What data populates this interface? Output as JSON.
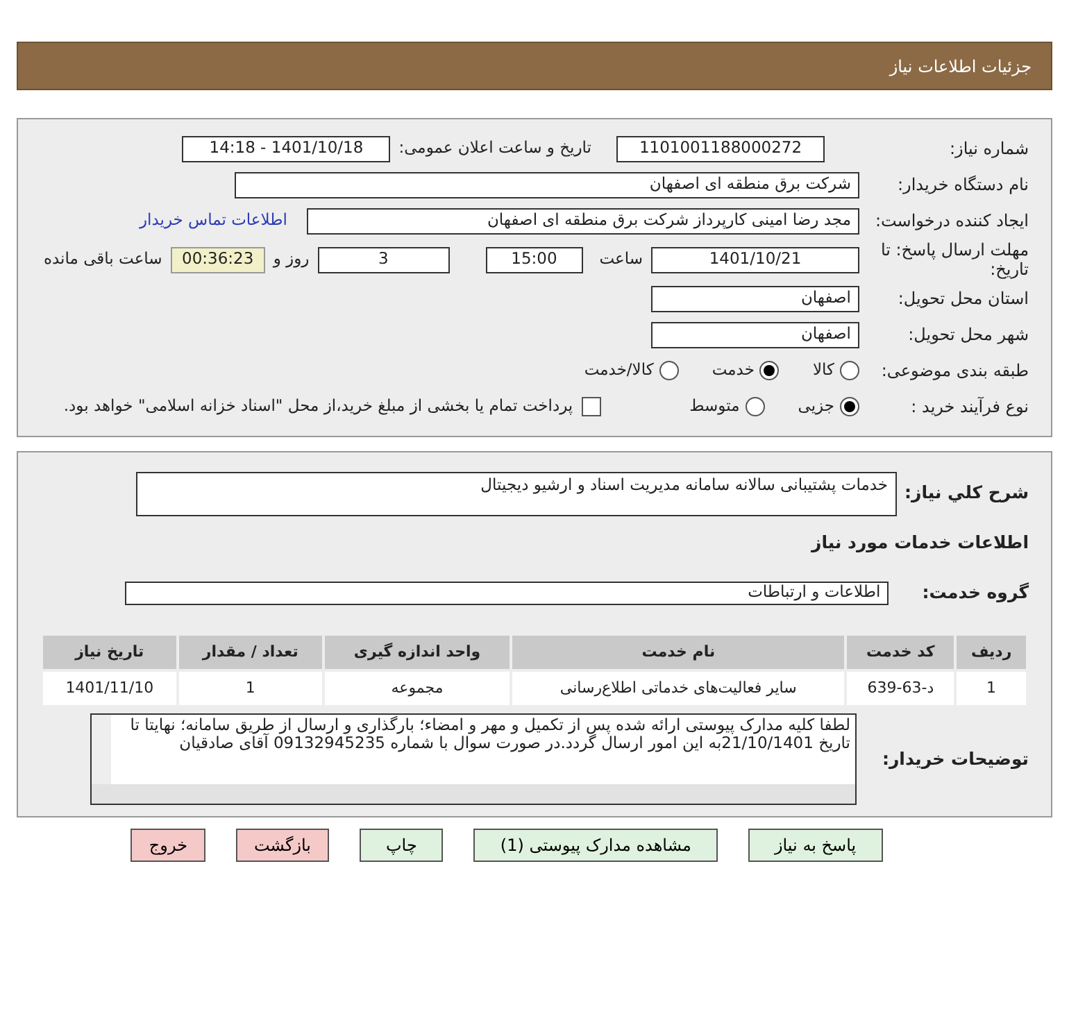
{
  "header": {
    "title": "جزئیات اطلاعات نیاز"
  },
  "need_number": {
    "label": "شماره نیاز:",
    "value": "1101001188000272"
  },
  "announce": {
    "label": "تاریخ و ساعت اعلان عمومی:",
    "value": "1401/10/18 - 14:18"
  },
  "buyer_org": {
    "label": "نام دستگاه خریدار:",
    "value": "شرکت برق منطقه ای اصفهان"
  },
  "requester": {
    "label": "ایجاد کننده درخواست:",
    "value": "مجد رضا امینی کارپرداز شرکت برق منطقه ای اصفهان",
    "link": "اطلاعات تماس خریدار"
  },
  "deadline": {
    "label": "مهلت ارسال پاسخ: تا تاریخ:",
    "date": "1401/10/21",
    "time_label": "ساعت",
    "time": "15:00",
    "days": "3",
    "days_label": "روز و",
    "remaining": "00:36:23",
    "remaining_label": "ساعت باقی مانده"
  },
  "province": {
    "label": "استان محل تحویل:",
    "value": "اصفهان"
  },
  "city": {
    "label": "شهر محل تحویل:",
    "value": "اصفهان"
  },
  "category": {
    "label": "طبقه بندی موضوعی:",
    "options": [
      {
        "label": "کالا",
        "selected": false
      },
      {
        "label": "خدمت",
        "selected": true
      },
      {
        "label": "کالا/خدمت",
        "selected": false
      }
    ]
  },
  "process": {
    "label": "نوع فرآیند خرید :",
    "options": [
      {
        "label": "جزیی",
        "selected": true
      },
      {
        "label": "متوسط",
        "selected": false
      }
    ],
    "payment": {
      "checked": false,
      "text": "پرداخت تمام یا بخشی از مبلغ خرید،از محل \"اسناد خزانه اسلامی\" خواهد بود."
    }
  },
  "summary": {
    "label": "شرح کلي نياز:",
    "value": "خدمات پشتیبانی سالانه سامانه مدیریت اسناد و ارشیو دیجیتال"
  },
  "services_title": "اطلاعات خدمات مورد نیاز",
  "service_group": {
    "label": "گروه خدمت:",
    "value": "اطلاعات و ارتباطات"
  },
  "table": {
    "columns": [
      "ردیف",
      "کد خدمت",
      "نام خدمت",
      "واحد اندازه گیری",
      "تعداد / مقدار",
      "تاریخ نیاز"
    ],
    "rows": [
      [
        "1",
        "د-63-639",
        "سایر فعالیت‌های خدماتی اطلاع‌رسانی",
        "مجموعه",
        "1",
        "1401/11/10"
      ]
    ]
  },
  "notes": {
    "label": "توضیحات خریدار:",
    "value": "لطفا کلیه مدارک پیوستی ارائه شده  پس از تکمیل و مهر و امضاء؛ بارگذاری و ارسال از طریق سامانه؛ نهایتا تا تاریخ 21/10/1401به این امور ارسال گردد.در صورت سوال با شماره 09132945235 آقای صادقیان"
  },
  "buttons": [
    {
      "label": "پاسخ به نیاز",
      "kind": "normal"
    },
    {
      "label": "مشاهده مدارک پیوستی (1)",
      "kind": "normal"
    },
    {
      "label": "چاپ",
      "kind": "normal"
    },
    {
      "label": "بازگشت",
      "kind": "danger"
    },
    {
      "label": "خروج",
      "kind": "danger"
    }
  ]
}
